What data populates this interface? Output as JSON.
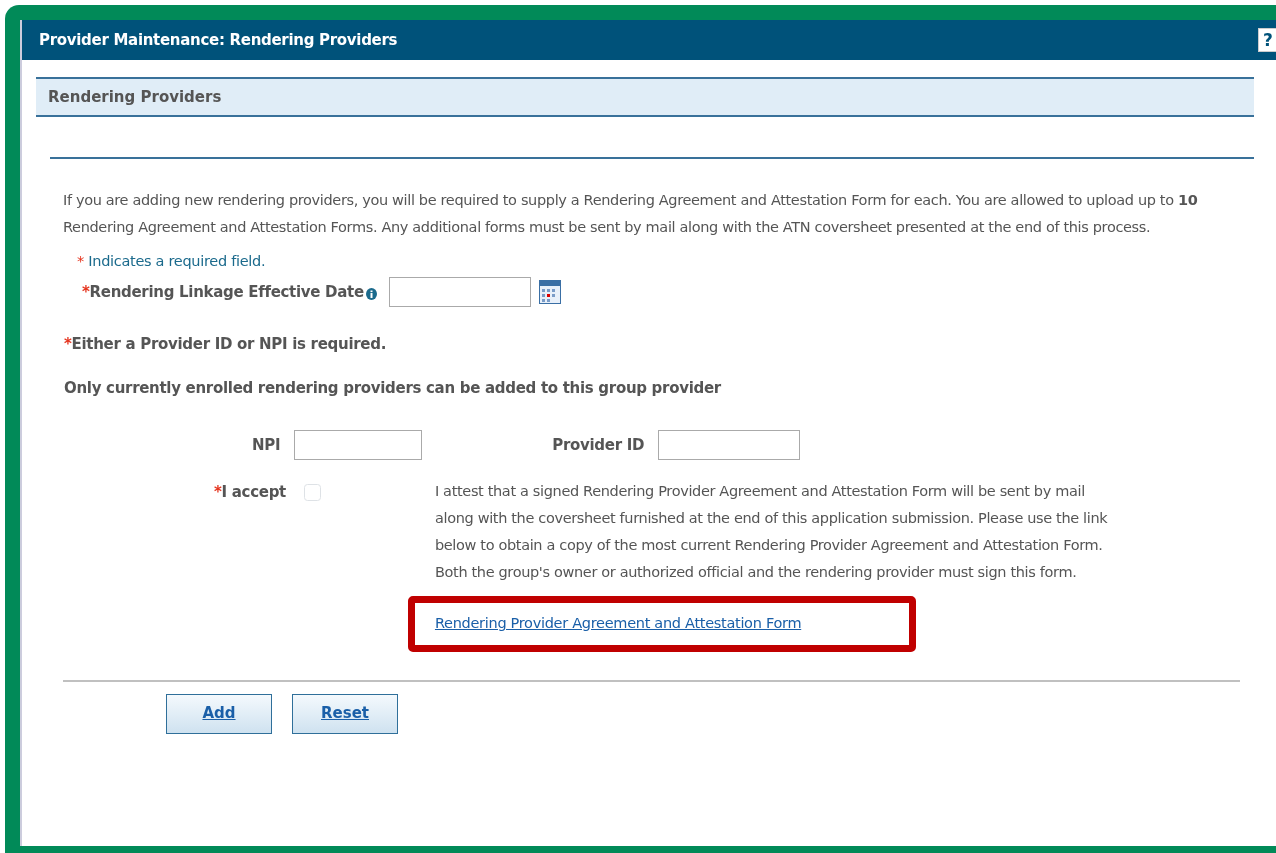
{
  "window": {
    "title": "Provider Maintenance: Rendering Providers",
    "help": "?"
  },
  "section": {
    "title": "Rendering Providers"
  },
  "intro": "If you are adding new rendering providers, you will be required to supply a Rendering Agreement and Attestation Form for each.  You are allowed to upload up to **10** Rendering Agreement and Attestation Forms.  Any additional forms must be sent by mail along with the ATN coversheet presented at the end of this process.",
  "required_note": {
    "mark": "*",
    "text": "Indicates a required field."
  },
  "date_field": {
    "mark": "*",
    "label": "Rendering Linkage Effective Date"
  },
  "either_note": {
    "mark": "*",
    "text": "Either a Provider ID or NPI is required."
  },
  "only_note": "Only currently enrolled rendering providers can be added to this group provider",
  "fields": [
    {
      "label": "NPI"
    },
    {
      "label": "Provider ID"
    }
  ],
  "accept": {
    "mark": "*",
    "label": "I accept",
    "checked": false
  },
  "attest": "I attest that a signed Rendering Provider Agreement and Attestation Form will be sent by mail along with the coversheet furnished at the end of this application submission.   Please use the link below to obtain a copy of the most current Rendering Provider Agreement and Attestation Form.  Both the group's owner or authorized official and the rendering provider must sign this form.",
  "form_link": {
    "text": "Rendering Provider Agreement and Attestation Form",
    "highlighted": true
  },
  "buttons": [
    "Add",
    "Reset"
  ]
}
